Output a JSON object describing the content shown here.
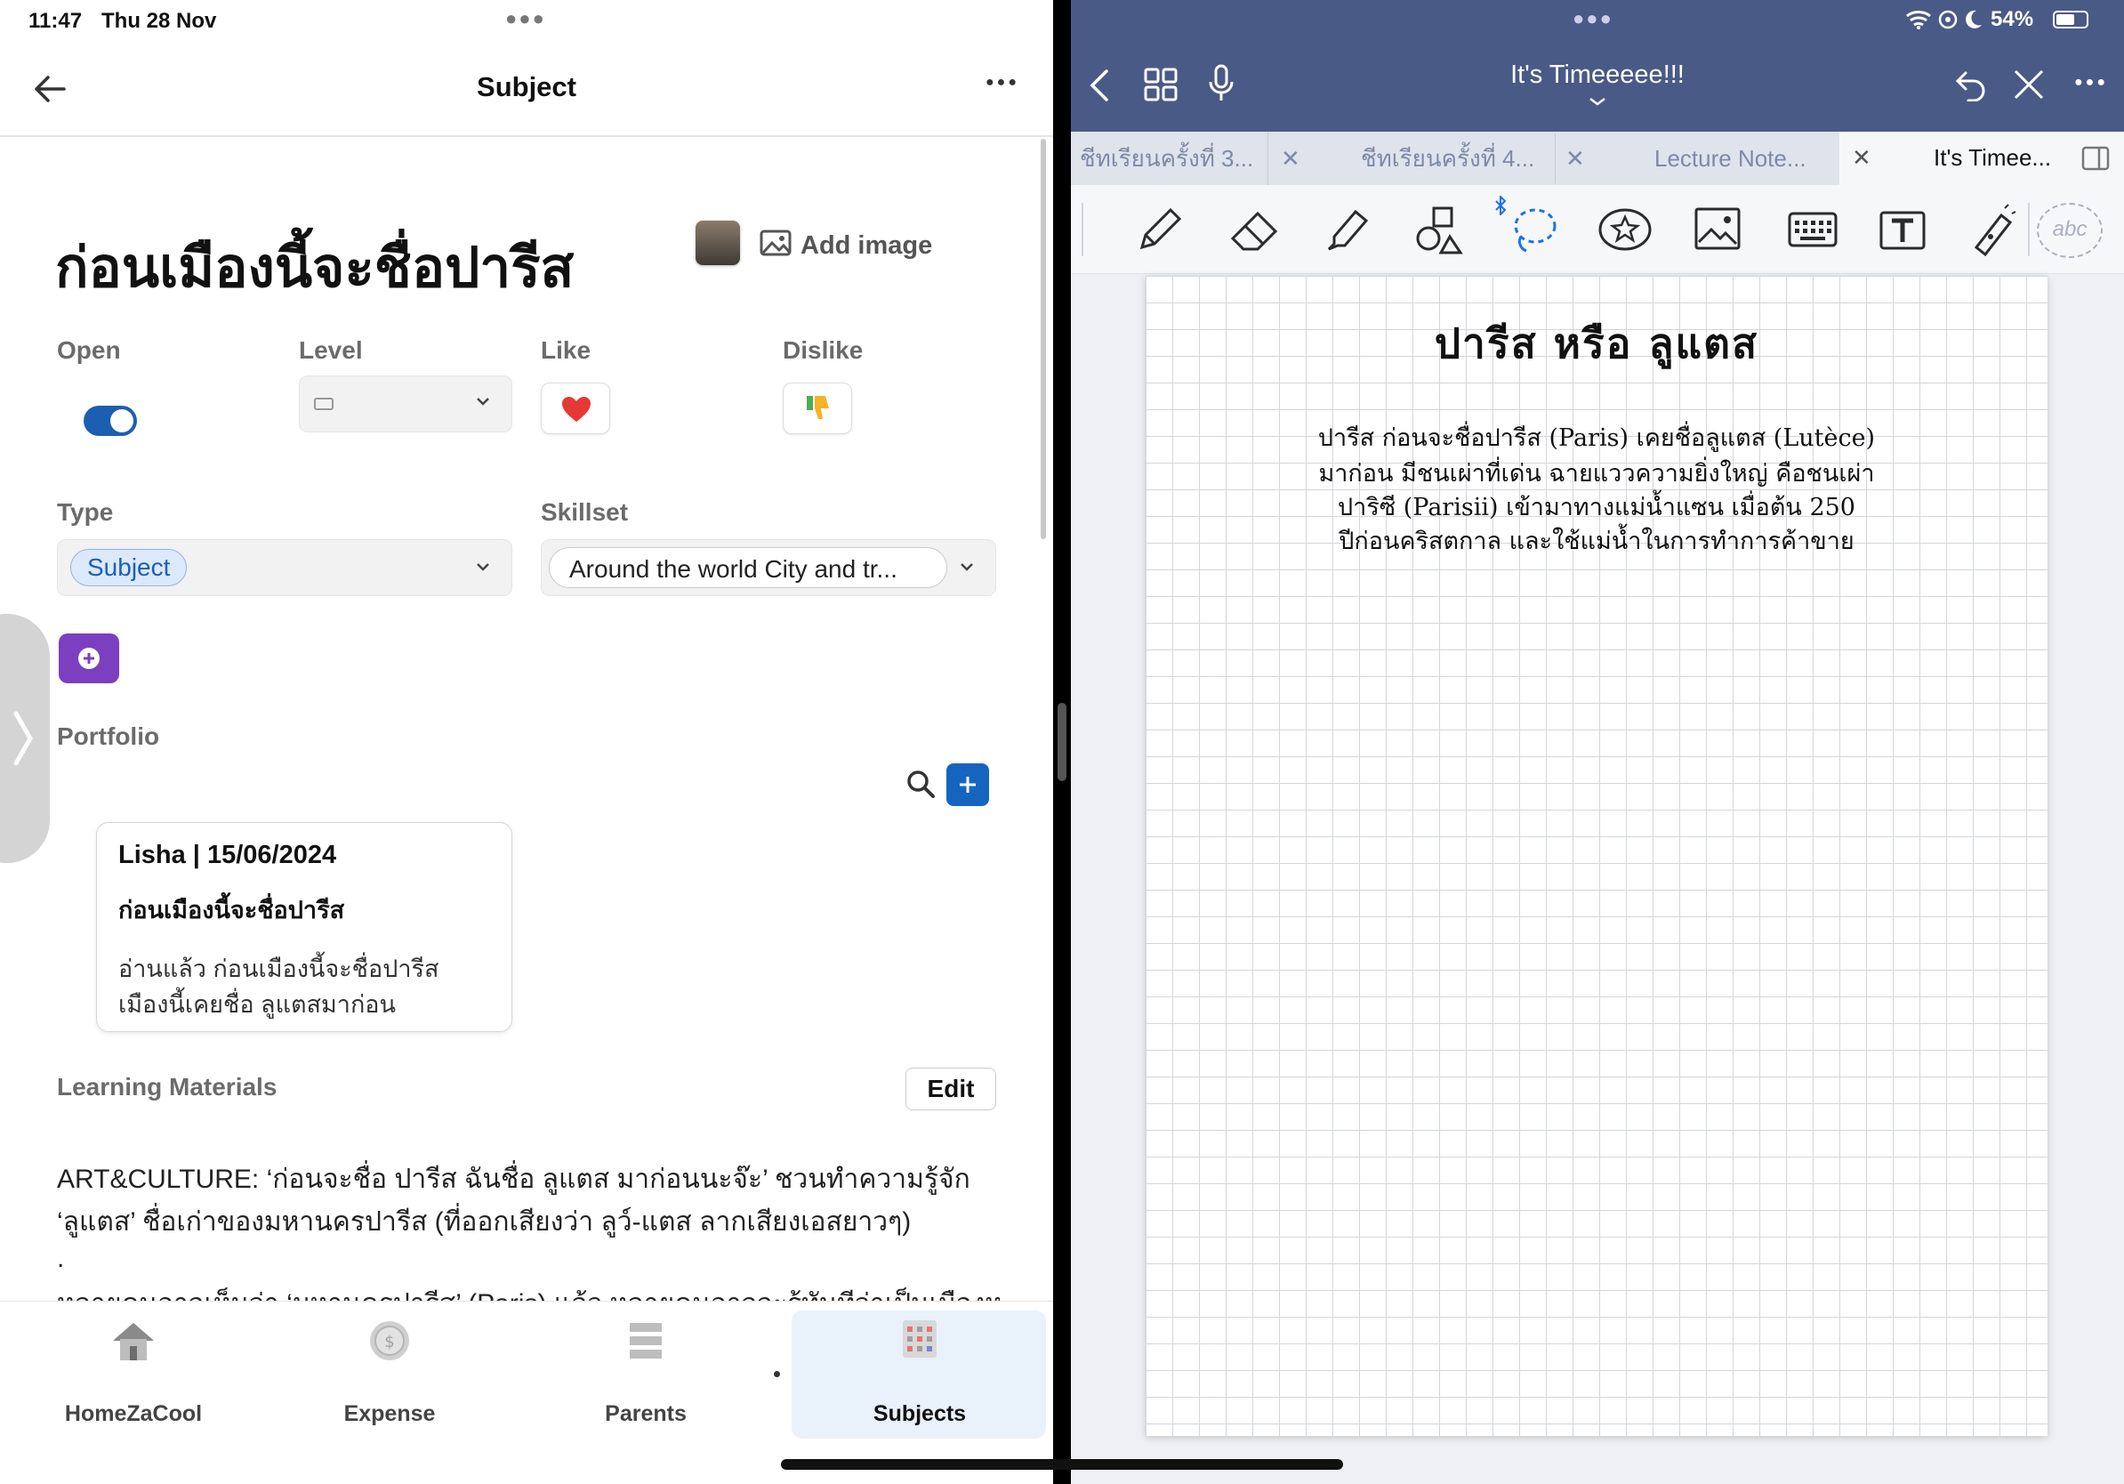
{
  "status": {
    "time": "11:47",
    "date": "Thu 28 Nov",
    "battery": "54%"
  },
  "left_app": {
    "header": {
      "title": "Subject"
    },
    "page_title": "ก่อนเมืองนี้จะชื่อปารีส",
    "add_image_label": "Add image",
    "fields": {
      "open_label": "Open",
      "level_label": "Level",
      "like_label": "Like",
      "dislike_label": "Dislike",
      "type_label": "Type",
      "type_value": "Subject",
      "skillset_label": "Skillset",
      "skillset_value": "Around the world City and tr..."
    },
    "open_toggle_on": true,
    "portfolio_label": "Portfolio",
    "portfolio_card": {
      "heading": "Lisha | 15/06/2024",
      "title": "ก่อนเมืองนี้จะชื่อปารีส",
      "body_line1": "อ่านแล้ว ก่อนเมืองนี้จะชื่อปารีส",
      "body_line2": "เมืองนี้เคยชื่อ ลูแตสมาก่อน"
    },
    "learning_label": "Learning Materials",
    "edit_label": "Edit",
    "article": {
      "line1": "ART&CULTURE: ‘ก่อนจะชื่อ ปารีส ฉันชื่อ ลูแตส มาก่อนนะจ๊ะ’ ชวนทำความรู้จัก",
      "line2": "‘ลูแตส’ ชื่อเก่าของมหานครปารีส (ที่ออกเสียงว่า ลูว์-แตส ลากเสียงเอสยาวๆ)",
      "line3": ".",
      "line4": "หลายคนอาจเห็นว่า ‘มหานครปารีส’ (Paris) แล้ว หลายคนอาจจะรู้ทันทีว่าเป็นเมืองหลวง"
    },
    "bottom_nav": [
      {
        "label": "HomeZaCool",
        "icon": "house-icon"
      },
      {
        "label": "Expense",
        "icon": "coin-icon"
      },
      {
        "label": "Parents",
        "icon": "stack-icon"
      },
      {
        "label": "Subjects",
        "icon": "calendar-grid-icon"
      }
    ]
  },
  "right_app": {
    "doc_title": "It's Timeeeee!!!",
    "tabs": [
      {
        "label": "ชีทเรียนครั้งที่ 3..."
      },
      {
        "label": "ชีทเรียนครั้งที่ 4..."
      },
      {
        "label": "Lecture Note..."
      },
      {
        "label": "It's Timee..."
      }
    ],
    "note": {
      "heading": "ปารีส หรือ ลูแตส",
      "line1": "ปารีส ก่อนจะชื่อปารีส (Paris) เคยชื่อลูแตส (Lutèce)",
      "line2": "มาก่อน มีชนเผ่าที่เด่น ฉายแววความยิ่งใหญ่ คือชนเผ่า",
      "line3": "ปาริซี (Parisii) เข้ามาทางแม่น้ำแซน เมื่อต้น 250",
      "line4": "ปีก่อนคริสตกาล และใช้แม่น้ำในการทำการค้าขาย"
    },
    "toolbar_placeholder": "abc"
  },
  "colors": {
    "accent_blue": "#1565c0",
    "toggle_blue": "#1c5fb0",
    "purple": "#7b3fc0",
    "notes_header": "#4a5a86"
  }
}
